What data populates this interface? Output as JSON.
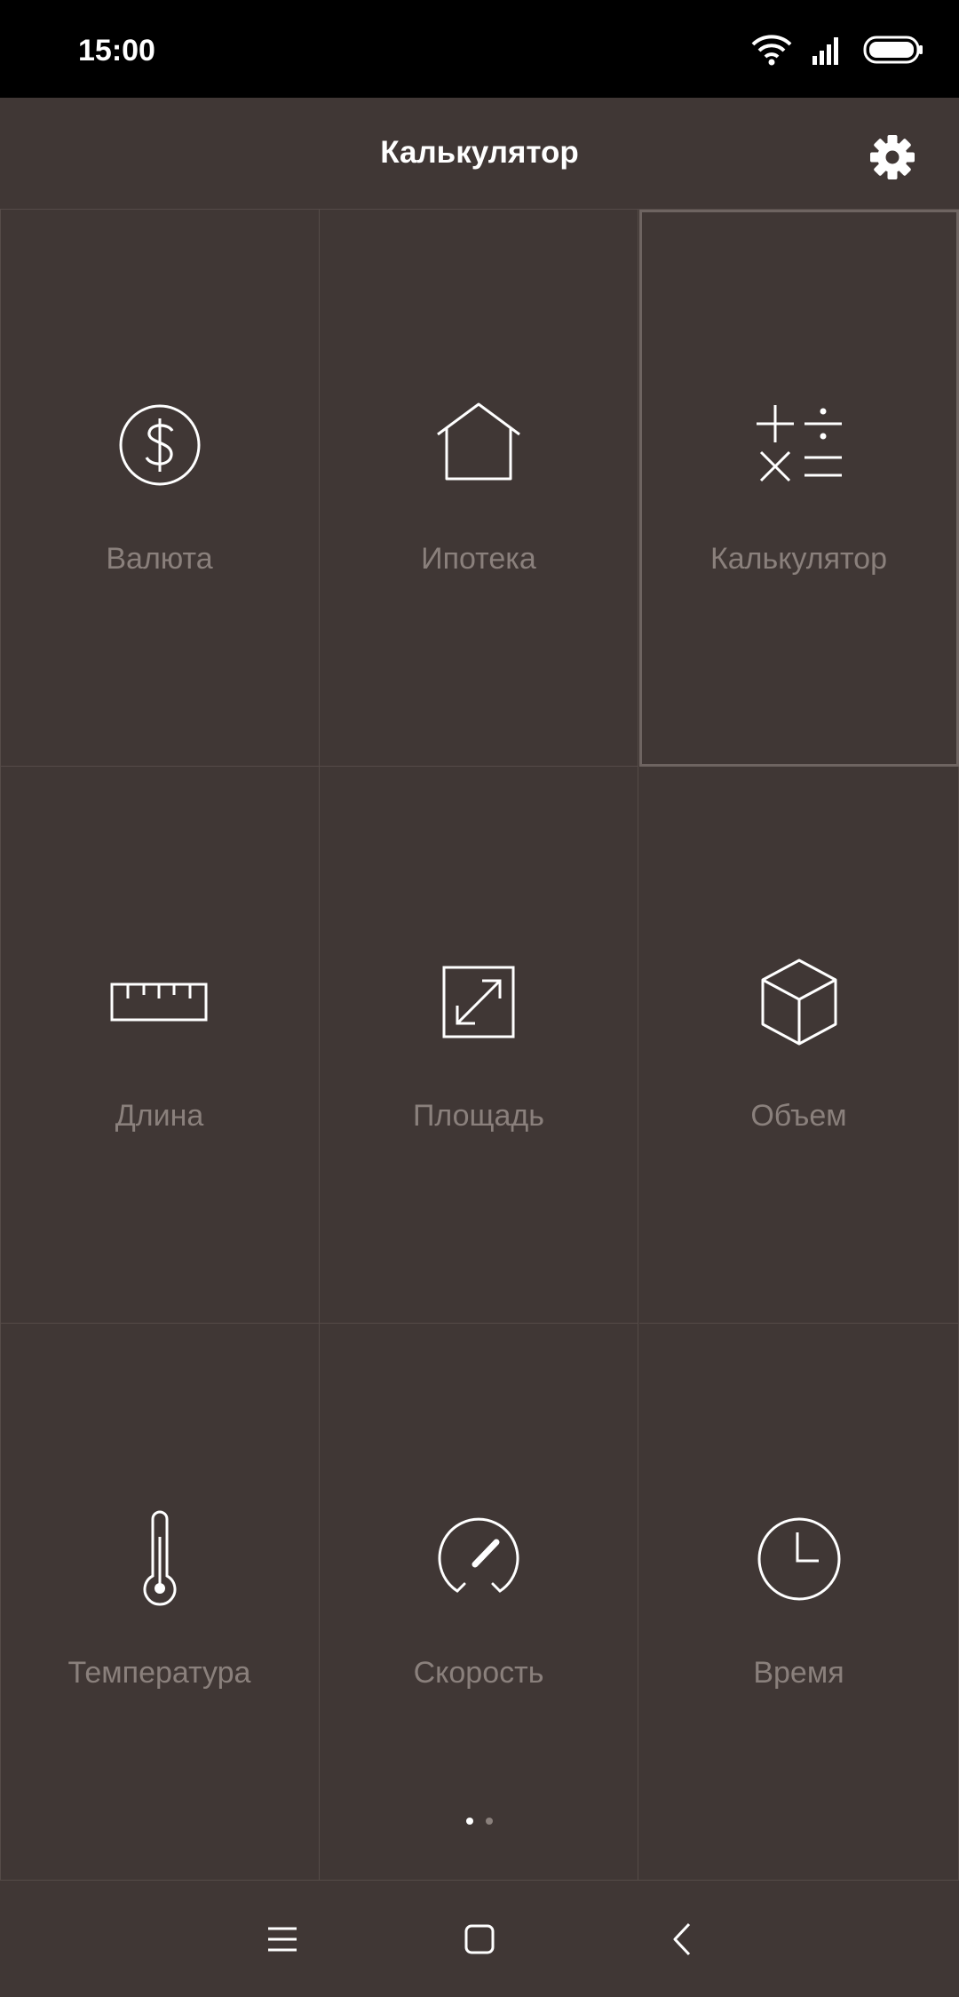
{
  "status_bar": {
    "time": "15:00"
  },
  "app_bar": {
    "title": "Калькулятор",
    "settings_icon": "gear-icon"
  },
  "grid": {
    "items": [
      {
        "label": "Валюта",
        "icon": "dollar-icon",
        "selected": false
      },
      {
        "label": "Ипотека",
        "icon": "house-icon",
        "selected": false
      },
      {
        "label": "Калькулятор",
        "icon": "calculator-icon",
        "selected": true
      },
      {
        "label": "Длина",
        "icon": "ruler-icon",
        "selected": false
      },
      {
        "label": "Площадь",
        "icon": "area-icon",
        "selected": false
      },
      {
        "label": "Объем",
        "icon": "cube-icon",
        "selected": false
      },
      {
        "label": "Температура",
        "icon": "thermometer-icon",
        "selected": false
      },
      {
        "label": "Скорость",
        "icon": "speedometer-icon",
        "selected": false
      },
      {
        "label": "Время",
        "icon": "clock-icon",
        "selected": false
      }
    ]
  },
  "pager": {
    "pages": 2,
    "current": 1
  },
  "nav_bar": {
    "menu_icon": "menu-icon",
    "home_icon": "home-icon",
    "back_icon": "back-icon"
  },
  "colors": {
    "background": "#403735",
    "status_bar": "#000000",
    "label": "#8a807c",
    "icon": "#ffffff",
    "divider": "#554b48"
  }
}
